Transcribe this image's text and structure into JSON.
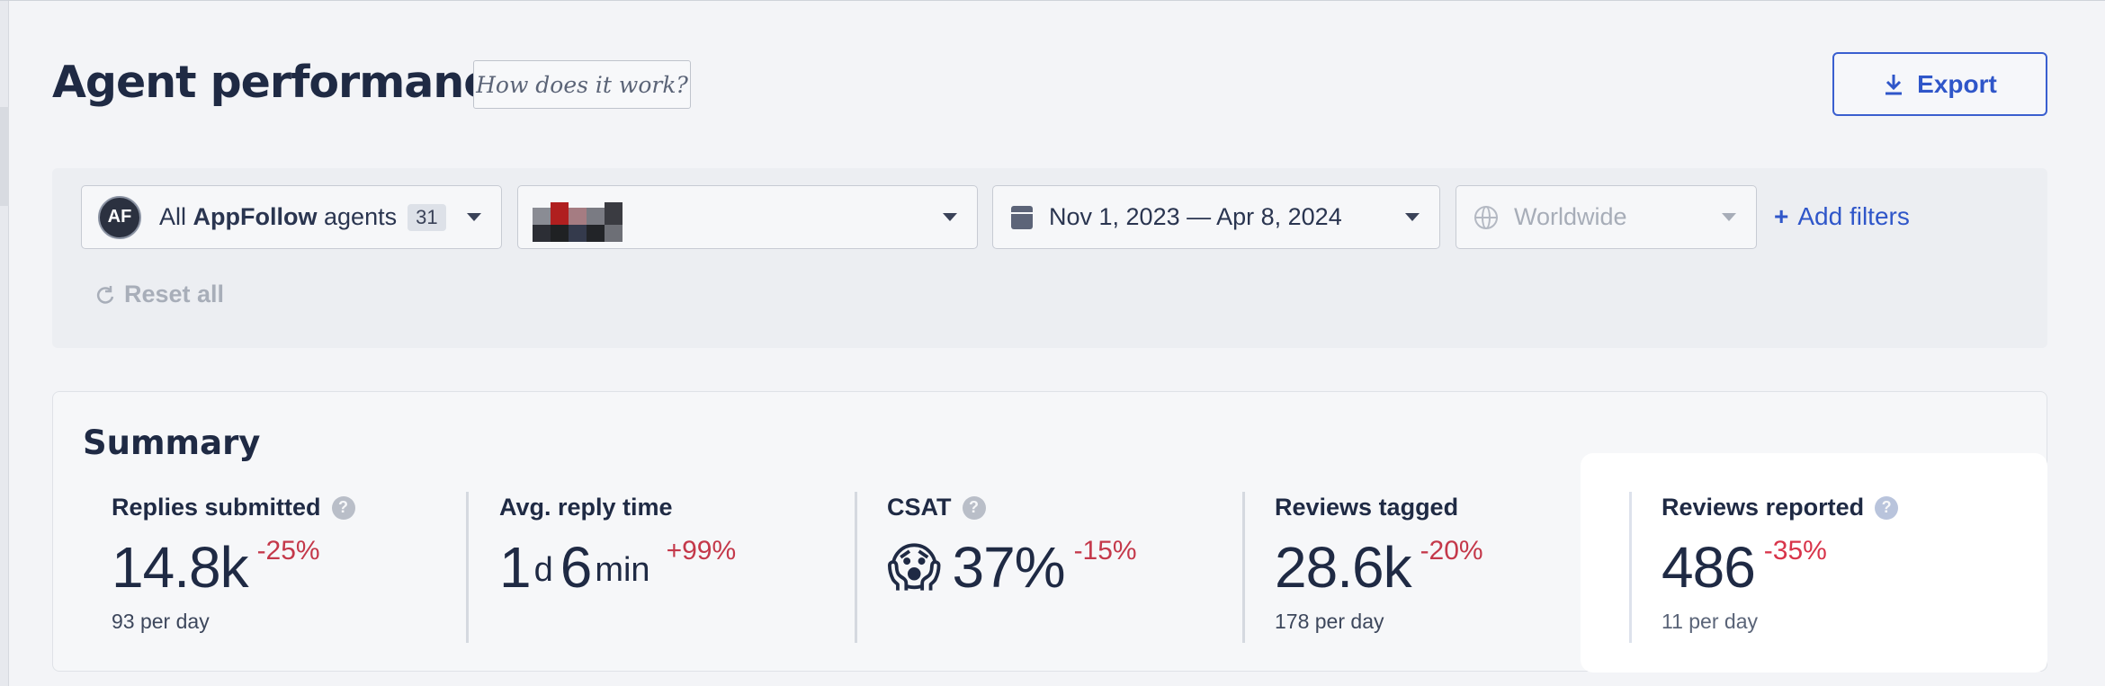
{
  "header": {
    "title": "Agent performance",
    "how_label": "How does it work?",
    "export_label": "Export"
  },
  "filters": {
    "agents": {
      "prefix": "All",
      "brand": "AppFollow",
      "suffix": "agents",
      "count": "31",
      "avatar": "AF"
    },
    "app": {
      "icon": "app-icon"
    },
    "date_range": "Nov 1, 2023 — Apr 8, 2024",
    "region": "Worldwide",
    "add_label": "Add filters",
    "reset_label": "Reset all"
  },
  "summary": {
    "title": "Summary",
    "metrics": [
      {
        "label": "Replies submitted",
        "value": "14.8k",
        "delta": "-25%",
        "sub": "93 per day",
        "help": true
      },
      {
        "label": "Avg. reply time",
        "value_days": "1",
        "unit_days": "d",
        "value_min": "6",
        "unit_min": "min",
        "delta": "+99%"
      },
      {
        "label": "CSAT",
        "value": "37%",
        "delta": "-15%",
        "emoji": "😱",
        "help": true
      },
      {
        "label": "Reviews tagged",
        "value": "28.6k",
        "delta": "-20%",
        "sub": "178 per day"
      },
      {
        "label": "Reviews reported",
        "value": "486",
        "delta": "-35%",
        "sub": "11 per day",
        "help": true
      }
    ]
  },
  "colors": {
    "accent": "#2f56c9",
    "negative": "#c4384a",
    "text": "#1f2a44"
  }
}
